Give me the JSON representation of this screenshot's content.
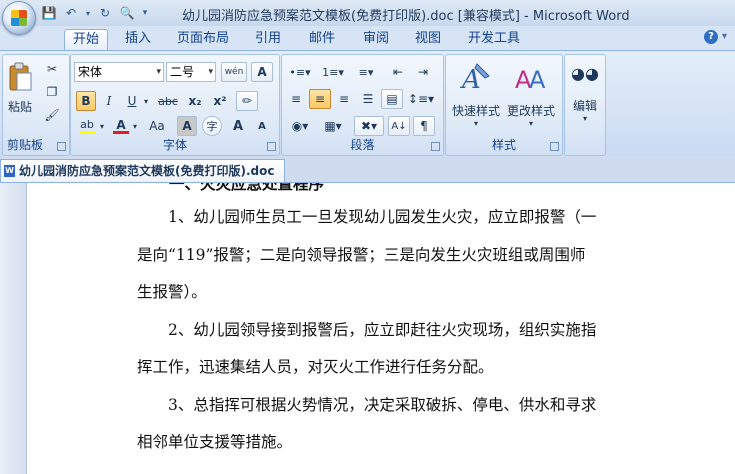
{
  "window": {
    "title": "幼儿园消防应急预案范文模板(免费打印版).doc [兼容模式] - Microsoft Word"
  },
  "ribbon": {
    "tabs": [
      "开始",
      "插入",
      "页面布局",
      "引用",
      "邮件",
      "审阅",
      "视图",
      "开发工具"
    ],
    "active_tab": "开始",
    "clipboard": {
      "label": "剪贴板",
      "paste": "粘贴"
    },
    "font": {
      "label": "字体",
      "font_name": "宋体",
      "font_size": "二号",
      "wen_button": "wén",
      "bold": "B",
      "italic": "I",
      "underline": "U",
      "strike": "abc",
      "sub": "x₂",
      "sup": "x²",
      "case": "Aa",
      "char_shade": "A",
      "enclose": "字",
      "grow": "A",
      "shrink": "A"
    },
    "paragraph": {
      "label": "段落"
    },
    "styles": {
      "label": "样式",
      "quick_styles": "快速样式",
      "change_styles": "更改样式"
    },
    "editing": {
      "label": "编辑",
      "editing_btn": "编辑"
    }
  },
  "document": {
    "tab_title": "幼儿园消防应急预案范文模板(免费打印版).doc",
    "lines": [
      "一、火灾应急处置程序",
      "1、幼儿园师生员工一旦发现幼儿园发生火灾，应立即报警（一",
      "是向“119”报警；二是向领导报警；三是向发生火灾班组或周围师",
      "生报警）。",
      "2、幼儿园领导接到报警后，应立即赶往火灾现场，组织实施指",
      "挥工作，迅速集结人员，对灭火工作进行任务分配。",
      "3、总指挥可根据火势情况，决定采取破拆、停电、供水和寻求",
      "相邻单位支援等措施。"
    ]
  },
  "colors": {
    "ribbon_bg": "#d2e1f4",
    "text_blue": "#15428b",
    "highlight": "#fbc864",
    "font_color_red": "#e02020",
    "highlighter_yellow": "#ffff00"
  }
}
